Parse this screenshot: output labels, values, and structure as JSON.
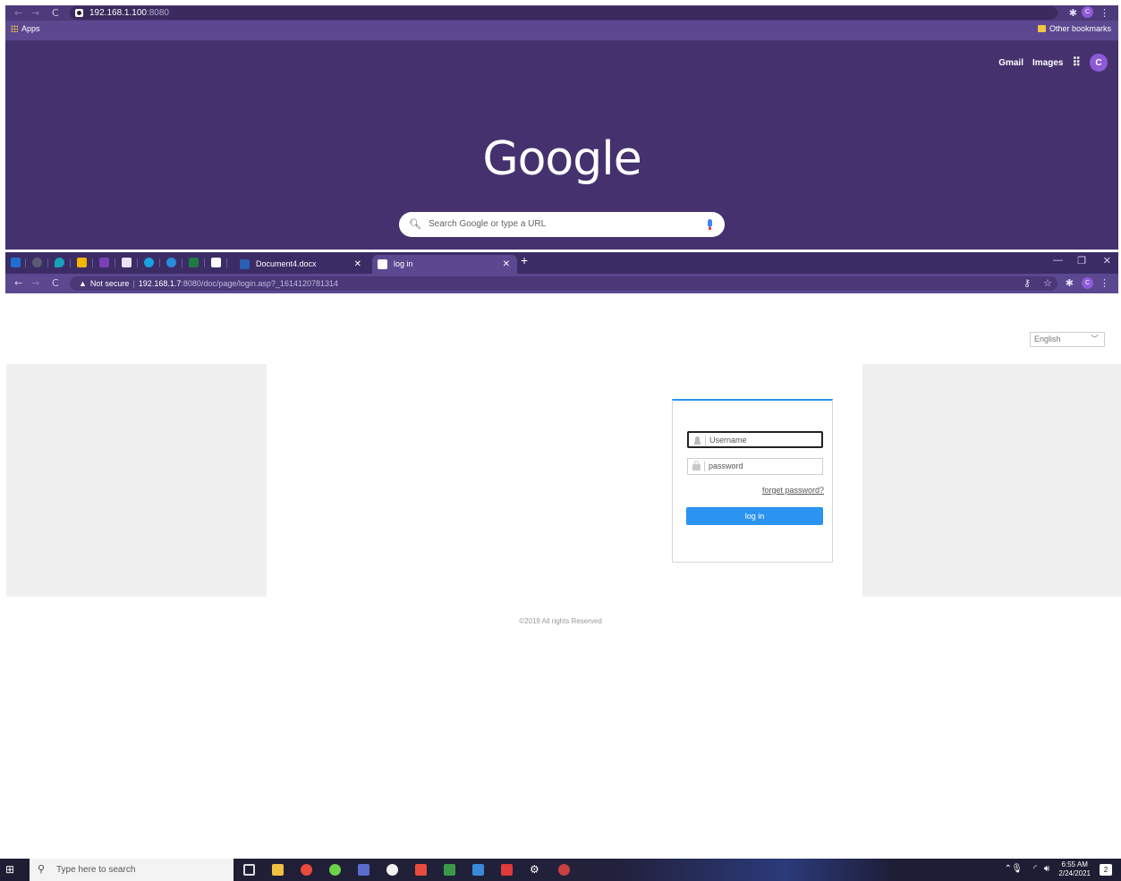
{
  "top_window": {
    "url_host": "192.168.1.100",
    "url_port": ":8080",
    "bookmarks_apps": "Apps",
    "other_bookmarks": "Other bookmarks",
    "profile_initial": "C",
    "google_links": {
      "gmail": "Gmail",
      "images": "Images"
    },
    "logo": "Google",
    "search_placeholder": "Search Google or type a URL"
  },
  "tabs": [
    {
      "title": "Document4.docx",
      "active": false
    },
    {
      "title": "log in",
      "active": true
    }
  ],
  "address_bar": {
    "security": "Not secure",
    "host": "192.168.1.7",
    "path": ":8080/doc/page/login.asp?_1614120781314"
  },
  "page": {
    "language": "English",
    "username_placeholder": "Username",
    "password_placeholder": "password",
    "forget_password": "forget password?",
    "login_button": "log in",
    "copyright": "©2019 All rights Reserved"
  },
  "taskbar": {
    "search_placeholder": "Type here to search",
    "time": "6:55 AM",
    "date": "2/24/2021",
    "notification_count": "2"
  },
  "colors": {
    "theme_purple": "#45316e",
    "accent_blue": "#2b93f0"
  }
}
